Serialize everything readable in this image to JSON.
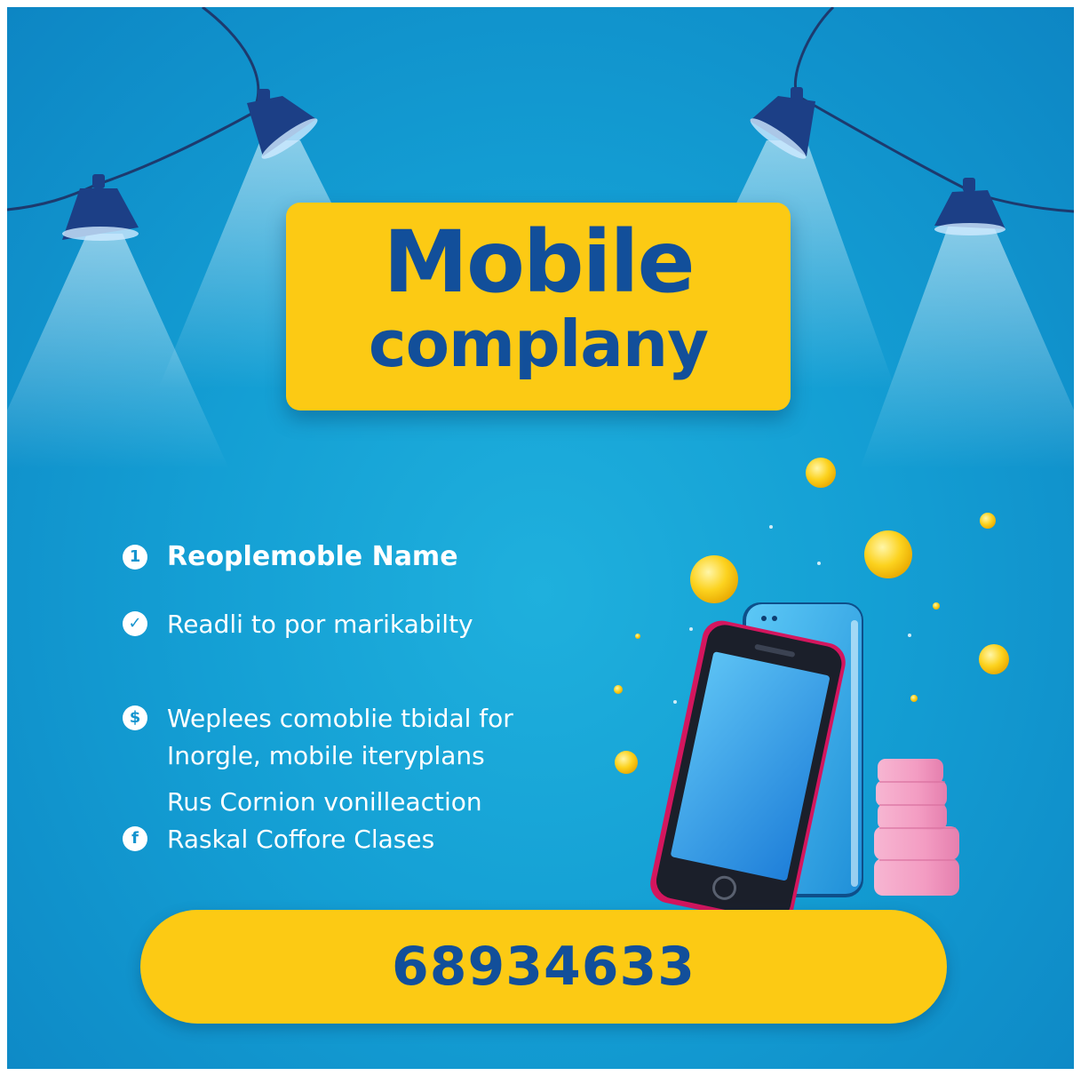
{
  "poster": {
    "title_line1": "Mobile",
    "title_line2": "complany",
    "features": [
      {
        "icon": "info-icon",
        "icon_glyph": "1",
        "text": "Reoplemoble Name"
      },
      {
        "icon": "check-icon",
        "icon_glyph": "✓",
        "text": "Readli to por marikabilty"
      },
      {
        "icon": "dollar-icon",
        "icon_glyph": "$",
        "text_line1": "Weplees comoblie tbidal for",
        "text_line2": "Inorgle, mobile iteryplans"
      },
      {
        "text": "Rus Cornion vonilleaction"
      },
      {
        "icon": "facebook-icon",
        "icon_glyph": "f",
        "text": "Raskal Coffore Clases"
      }
    ],
    "phone_number": "68934633"
  },
  "colors": {
    "background": "#149fd4",
    "accent_yellow": "#fcca14",
    "title_blue": "#124f9a",
    "coin_pink": "#f6a9c9",
    "phone_frame_magenta": "#d4165e",
    "lamp_navy": "#1c3f86"
  }
}
